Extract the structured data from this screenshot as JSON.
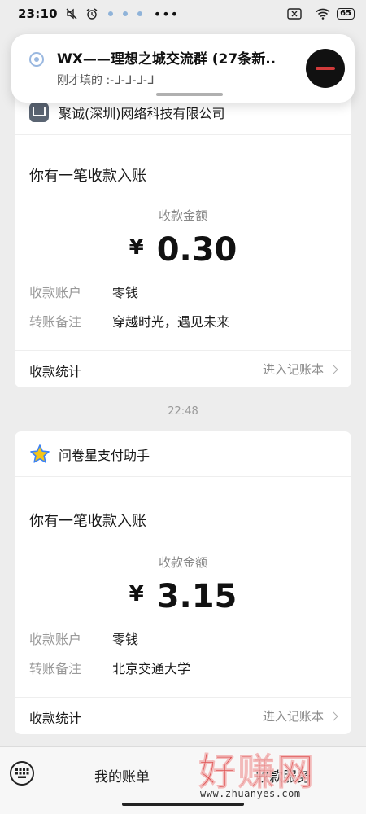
{
  "status_bar": {
    "time": "23:10",
    "more": "•••",
    "battery": "65"
  },
  "notification": {
    "title": "WX——理想之城交流群 (27条新..",
    "body": "刚才填的 :-ᒧ-ᒧ-ᒧ-ᒧ"
  },
  "cards": [
    {
      "sender": "聚诚(深圳)网络科技有限公司",
      "subtitle": "你有一笔收款入账",
      "amount_label": "收款金额",
      "currency": "¥",
      "amount": "0.30",
      "account_label": "收款账户",
      "account_value": "零钱",
      "note_label": "转账备注",
      "note_value": "穿越时光，遇见未来",
      "stats_label": "收款统计",
      "ledger_label": "进入记账本"
    },
    {
      "sender": "问卷星支付助手",
      "subtitle": "你有一笔收款入账",
      "amount_label": "收款金额",
      "currency": "¥",
      "amount": "3.15",
      "account_label": "收款账户",
      "account_value": "零钱",
      "note_label": "转账备注",
      "note_value": "北京交通大学",
      "stats_label": "收款统计",
      "ledger_label": "进入记账本"
    }
  ],
  "timestamp": "22:48",
  "bottom_bar": {
    "my_bills": "我的账单",
    "collect_service": "收款服务"
  },
  "watermark": {
    "big": "好赚网",
    "small": "www.zhuanyes.com"
  },
  "colors": {
    "background": "#ededed",
    "card": "#ffffff",
    "muted_text": "#999999",
    "watermark_red": "#d93030",
    "star_yellow": "#f5c518",
    "star_blue": "#3b82f6"
  }
}
